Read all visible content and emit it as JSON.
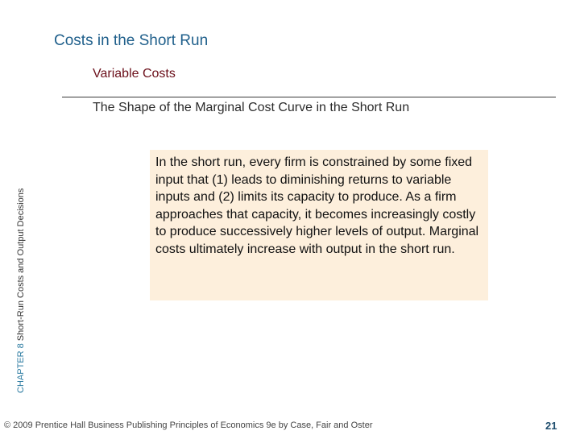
{
  "slide": {
    "title": "Costs in the Short Run",
    "section": "Variable Costs",
    "subsection": "The Shape of the Marginal Cost Curve in the Short Run",
    "body": "In the short run, every firm is constrained by some fixed input that (1) leads to diminishing returns to variable inputs and (2) limits its capacity to produce.  As a firm approaches that capacity, it becomes increasingly costly to produce successively higher levels of output.  Marginal costs ultimately increase with output in the short run."
  },
  "sidebar": {
    "chapter": "CHAPTER 8",
    "chapter_title": "Short-Run Costs and Output Decisions"
  },
  "footer": {
    "copyright": "© 2009 Prentice Hall Business Publishing   Principles of Economics 9e by Case, Fair and Oster",
    "page_number": "21"
  },
  "colors": {
    "title": "#1f5f8b",
    "section": "#6b0f1a",
    "text_box_background": "#fdefdc",
    "chapter_label": "#2a7aa0",
    "page_number": "#1f4e6e"
  }
}
